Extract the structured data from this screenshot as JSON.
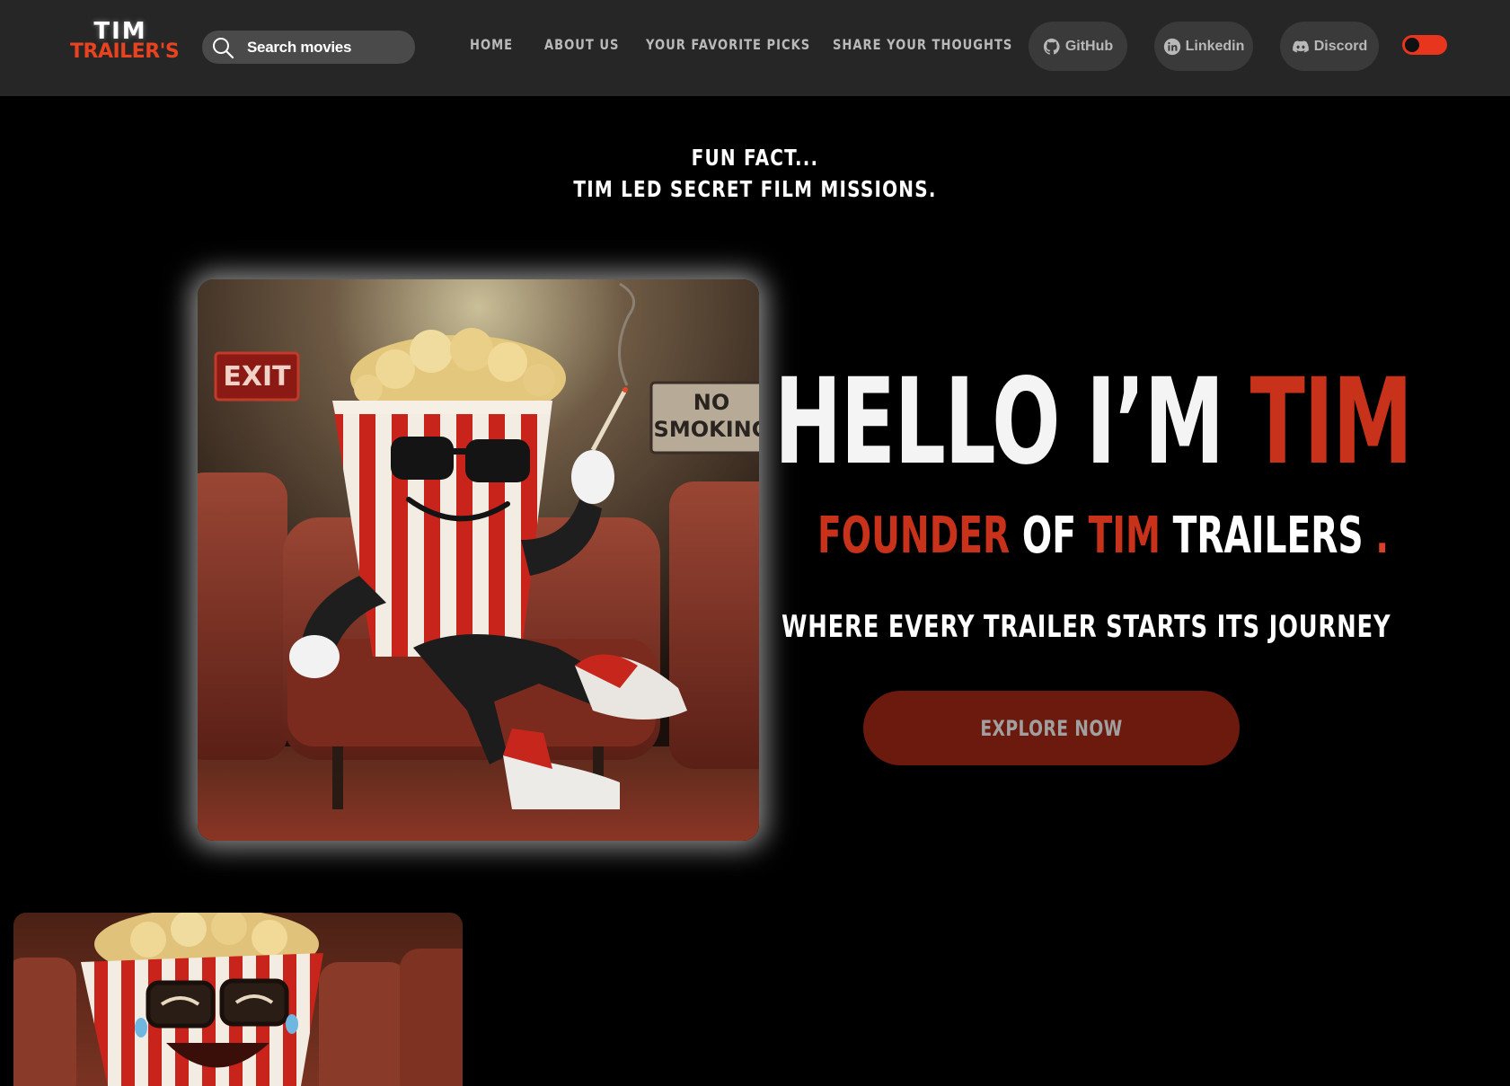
{
  "logo": {
    "line1": "TIM",
    "line2": "TRAILER'S"
  },
  "search": {
    "placeholder": "Search movies"
  },
  "nav": [
    "HOME",
    "ABOUT US",
    "YOUR FAVORITE PICKS",
    "SHARE YOUR THOUGHTS"
  ],
  "social": {
    "github": "GitHub",
    "linkedin": "Linkedin",
    "discord": "Discord"
  },
  "fun_fact": {
    "line1": "FUN FACT...",
    "line2": "TIM LED SECRET FILM MISSIONS."
  },
  "hero": {
    "hello": "HELLO I’M ",
    "name": "TIM",
    "founder_1": "FOUNDER",
    "founder_2": " OF ",
    "founder_3": "TIM",
    "founder_4": " TRAILERS ",
    "founder_dot": ".",
    "tagline": "WHERE EVERY TRAILER STARTS ITS JOURNEY",
    "cta": "EXPLORE NOW"
  },
  "image_signs": {
    "exit": "EXIT",
    "no_smoking_1": "NO",
    "no_smoking_2": "SMOKING"
  },
  "colors": {
    "accent": "#c8311a",
    "header_bg": "#262626",
    "cta_bg": "#6b1a0d",
    "toggle": "#e8351e"
  },
  "icons": [
    "search-icon",
    "github-icon",
    "linkedin-icon",
    "discord-icon"
  ]
}
